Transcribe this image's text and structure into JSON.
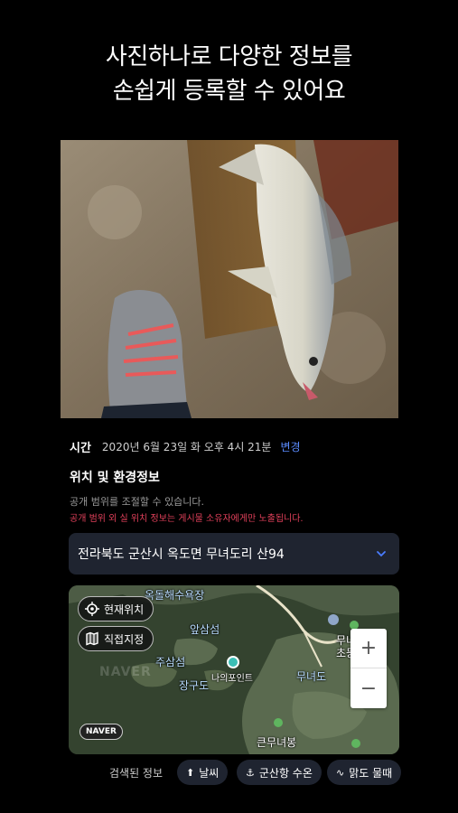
{
  "headline": {
    "line1": "사진하나로 다양한 정보를",
    "line2": "손쉽게 등록할 수 있어요"
  },
  "time": {
    "label": "시간",
    "value": "2020년 6월 23일 화 오후 4시 21분",
    "change_label": "변경"
  },
  "location": {
    "title": "위치 및 환경정보",
    "desc": "공개 범위를 조절할 수 있습니다.",
    "warning": "공개 범위 외 실 위치 정보는 게시물 소유자에게만 노출됩니다.",
    "address": "전라북도 군산시 옥도면 무녀도리 산94"
  },
  "map": {
    "current_location_button": "현재위치",
    "set_location_button": "직접지정",
    "zoom_in": "+",
    "zoom_out": "−",
    "naver_badge": "NAVER",
    "watermark": "NAVER",
    "labels": {
      "beach": "옥돌해수욕장",
      "apsam": "앞삼섬",
      "jusam": "주삼섬",
      "janggu": "장구도",
      "point": "나의포인트",
      "munyeo": "무녀도",
      "school": "초등학교",
      "munyeo2": "무녀도",
      "peak": "큰무녀봉"
    }
  },
  "found": {
    "label": "검색된 정보",
    "chips": {
      "weather": "날씨",
      "water": "군산항 수온",
      "tide": "맑도 물때"
    }
  },
  "colors": {
    "accent": "#5a8bff",
    "warning": "#e0405a",
    "panel": "#1f2430"
  }
}
